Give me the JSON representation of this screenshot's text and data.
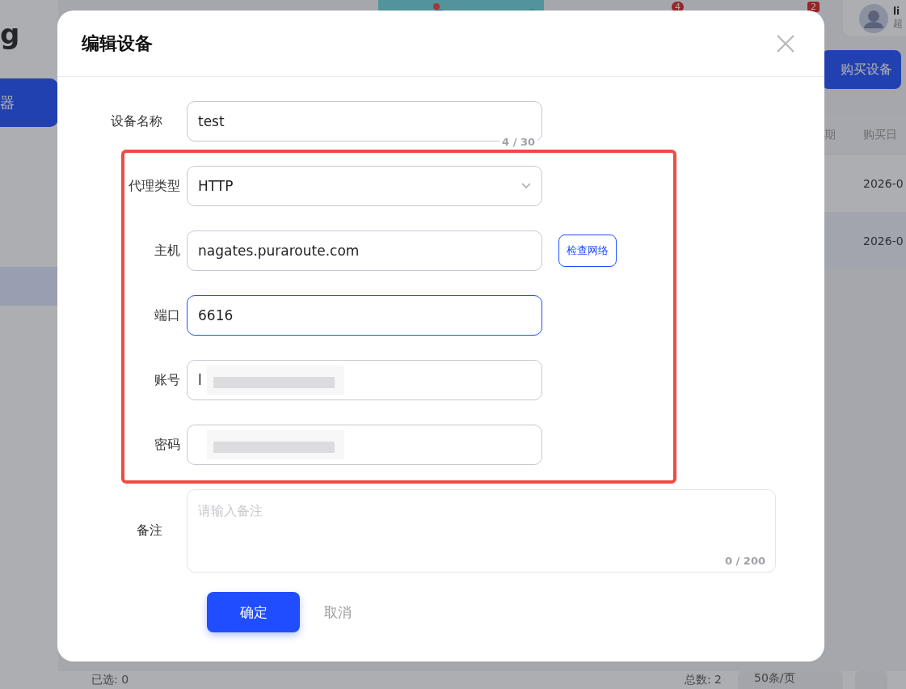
{
  "page": {
    "logo": "g",
    "sidebar_button": "器",
    "notification_count": "4",
    "message_count": "2",
    "user_name": "li",
    "user_role": "超",
    "buy_button": "购买设备",
    "table": {
      "columns": [
        "期",
        "购买日"
      ],
      "rows": [
        {
          "date": "2026-0"
        },
        {
          "date": "2026-0"
        }
      ]
    },
    "selected_count": "已选: 0",
    "total": "总数: 2",
    "page_size": "50条/页"
  },
  "dialog": {
    "title": "编辑设备",
    "sections": [
      {
        "highlighted": false,
        "fields": [
          {
            "label": "设备名称",
            "kind": "text",
            "value": "test",
            "counter": "4 / 30",
            "focused": false
          }
        ]
      },
      {
        "highlighted": true,
        "fields": [
          {
            "label": "代理类型",
            "kind": "select",
            "value": "HTTP",
            "focused": false
          },
          {
            "label": "主机",
            "kind": "text",
            "value": "nagates.puraroute.com",
            "action": "检查网络",
            "focused": false
          },
          {
            "label": "端口",
            "kind": "text",
            "value": "6616",
            "focused": true
          },
          {
            "label": "账号",
            "kind": "text",
            "value": "l",
            "focused": false,
            "redacted": true
          },
          {
            "label": "密码",
            "kind": "text",
            "focused": false,
            "redacted": true
          }
        ]
      },
      {
        "highlighted": false,
        "fields": [
          {
            "label": "备注",
            "kind": "textarea",
            "placeholder": "请输入备注",
            "counter": "0 / 200",
            "focused": false
          }
        ]
      }
    ],
    "buttons": [
      {
        "label": "确定",
        "kind": "primary"
      },
      {
        "label": "取消",
        "kind": "text"
      }
    ]
  }
}
